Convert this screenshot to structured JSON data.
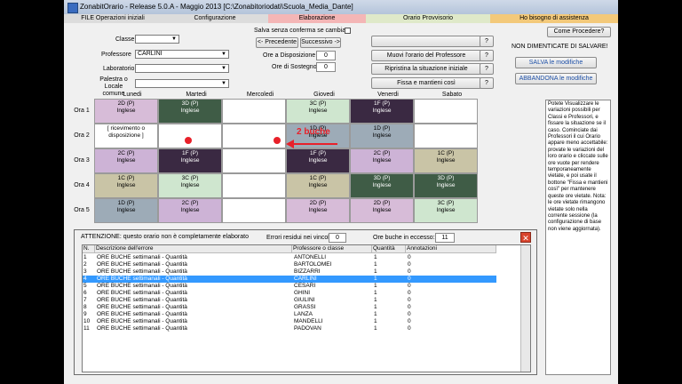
{
  "window": {
    "title": "ZonabitOrario - Release 5.0.A - Maggio 2013 [C:\\Zonabitoriodati\\Scuola_Media_Dante]"
  },
  "tabs": [
    {
      "label": "FILE Operazioni iniziali",
      "color": "#dcdcdc"
    },
    {
      "label": "Configurazione",
      "color": "#dcdcdc"
    },
    {
      "label": "Elaborazione",
      "color": "#f4b6b6"
    },
    {
      "label": "Orario Provvisorio",
      "color": "#dfe9c9"
    },
    {
      "label": "Ho bisogno di assistenza",
      "color": "#f3c97a"
    }
  ],
  "form": {
    "classe_label": "Classe",
    "professore_label": "Professore",
    "professore_value": "CARLINI",
    "laboratorio_label": "Laboratorio",
    "palestra_label": "Palestra o Locale comune",
    "conferma_label": "Salva senza conferma se cambiato",
    "precedente_label": "<- Precedente",
    "successivo_label": "Successivo ->",
    "disposizione_label": "Ore a Disposizione",
    "disposizione_value": "0",
    "sostegno_label": "Ore di Sostegno",
    "sostegno_value": "0",
    "muovi_label": "Muovi l'orario del Professore",
    "ripristina_label": "Ripristina la situazione iniziale",
    "fissa_label": "Fissa e mantieni così",
    "help_label": "?",
    "come_procedere_label": "Come Procedere?",
    "non_dimenticate_label": "NON DIMENTICATE DI SALVARE!",
    "salva_label": "SALVA le modifiche",
    "abbandona_label": "ABBANDONA le modifiche"
  },
  "timetable": {
    "days": [
      "Lunedi",
      "Martedi",
      "Mercoledi",
      "Giovedi",
      "Venerdi",
      "Sabato"
    ],
    "hours": [
      "Ora 1",
      "Ora 2",
      "Ora 3",
      "Ora 4",
      "Ora 5"
    ],
    "cells": [
      [
        {
          "l1": "2D  (P)",
          "l2": "Inglese",
          "bg": "#d7bcd8",
          "fg": "#000"
        },
        {
          "l1": "3D  (P)",
          "l2": "Inglese",
          "bg": "#3f5c46",
          "fg": "#fff"
        },
        {
          "l1": "",
          "l2": "",
          "bg": "#ffffff",
          "fg": "#000"
        },
        {
          "l1": "3C  (P)",
          "l2": "Inglese",
          "bg": "#cfe6cf",
          "fg": "#000"
        },
        {
          "l1": "1F  (P)",
          "l2": "Inglese",
          "bg": "#3a2942",
          "fg": "#fff"
        },
        {
          "l1": "",
          "l2": "",
          "bg": "#ffffff",
          "fg": "#000"
        }
      ],
      [
        {
          "l1": "[ ricevimento o",
          "l2": "disposizione ]",
          "bg": "#ffffff",
          "fg": "#000"
        },
        {
          "l1": "",
          "l2": "",
          "bg": "#ffffff",
          "fg": "#000"
        },
        {
          "l1": "",
          "l2": "",
          "bg": "#ffffff",
          "fg": "#000"
        },
        {
          "l1": "1D  (P)",
          "l2": "Inglese",
          "bg": "#9dabb7",
          "fg": "#000"
        },
        {
          "l1": "1D  (P)",
          "l2": "Inglese",
          "bg": "#9dabb7",
          "fg": "#000"
        },
        {
          "l1": "",
          "l2": "",
          "bg": "#ffffff",
          "fg": "#000"
        }
      ],
      [
        {
          "l1": "2C  (P)",
          "l2": "Inglese",
          "bg": "#cdb3d6",
          "fg": "#000"
        },
        {
          "l1": "1F  (P)",
          "l2": "Inglese",
          "bg": "#3a2942",
          "fg": "#fff"
        },
        {
          "l1": "",
          "l2": "",
          "bg": "#ffffff",
          "fg": "#000"
        },
        {
          "l1": "1F  (P)",
          "l2": "Inglese",
          "bg": "#3a2942",
          "fg": "#fff"
        },
        {
          "l1": "2C  (P)",
          "l2": "Inglese",
          "bg": "#cdb3d6",
          "fg": "#000"
        },
        {
          "l1": "1C  (P)",
          "l2": "Inglese",
          "bg": "#c9c4a6",
          "fg": "#000"
        }
      ],
      [
        {
          "l1": "1C  (P)",
          "l2": "Inglese",
          "bg": "#c9c4a6",
          "fg": "#000"
        },
        {
          "l1": "3C  (P)",
          "l2": "Inglese",
          "bg": "#cfe6cf",
          "fg": "#000"
        },
        {
          "l1": "",
          "l2": "",
          "bg": "#ffffff",
          "fg": "#000"
        },
        {
          "l1": "1C  (P)",
          "l2": "Inglese",
          "bg": "#c9c4a6",
          "fg": "#000"
        },
        {
          "l1": "3D  (P)",
          "l2": "Inglese",
          "bg": "#3f5c46",
          "fg": "#fff"
        },
        {
          "l1": "3D  (P)",
          "l2": "Inglese",
          "bg": "#3f5c46",
          "fg": "#fff"
        }
      ],
      [
        {
          "l1": "1D  (P)",
          "l2": "Inglese",
          "bg": "#9dabb7",
          "fg": "#000"
        },
        {
          "l1": "2C  (P)",
          "l2": "Inglese",
          "bg": "#cdb3d6",
          "fg": "#000"
        },
        {
          "l1": "",
          "l2": "",
          "bg": "#ffffff",
          "fg": "#000"
        },
        {
          "l1": "2D  (P)",
          "l2": "Inglese",
          "bg": "#d7bcd8",
          "fg": "#000"
        },
        {
          "l1": "2D  (P)",
          "l2": "Inglese",
          "bg": "#d7bcd8",
          "fg": "#000"
        },
        {
          "l1": "3C  (P)",
          "l2": "Inglese",
          "bg": "#cfe6cf",
          "fg": "#000"
        }
      ]
    ],
    "annotation": "2 buche",
    "accent_red": "#e8212a"
  },
  "side_help": "Potete Visualizzare le variazioni possibili per Classi e Professori, e fissare la situazione se il caso. Cominciate dai Professori il cui Orario appare meno accettabile: provate le variazioni del loro orario e cliccate sulle ore vuote per rendere temporaneamente vietate, e poi usate il bottone \"Fissa e mantieni così\" per mantenere queste ore vietate. Nota: le ore vietate rimangono vietate solo nella corrente sessione (la configurazione di base non viene aggiornata).",
  "dialog": {
    "attention": "ATTENZIONE: questo orario non è completamente elaborato",
    "errori_label": "Errori residui nei vincoli",
    "errori_value": "0",
    "buche_label": "Ore buche in eccesso:",
    "buche_value": "11",
    "close_glyph": "✕",
    "columns": [
      "N.",
      "Descrizione dell'errore",
      "Professore o classe",
      "Quantità",
      "Annotazioni"
    ],
    "rows": [
      {
        "n": "1",
        "desc": "ORE BUCHE settimanali - Quantità",
        "prof": "ANTONELLI",
        "qty": "1",
        "ann": "0"
      },
      {
        "n": "2",
        "desc": "ORE BUCHE settimanali - Quantità",
        "prof": "BARTOLOMEI",
        "qty": "1",
        "ann": "0"
      },
      {
        "n": "3",
        "desc": "ORE BUCHE settimanali - Quantità",
        "prof": "BIZZARRI",
        "qty": "1",
        "ann": "0"
      },
      {
        "n": "4",
        "desc": "ORE BUCHE settimanali - Quantità",
        "prof": "CARLINI",
        "qty": "1",
        "ann": "0"
      },
      {
        "n": "5",
        "desc": "ORE BUCHE settimanali - Quantità",
        "prof": "CESARI",
        "qty": "1",
        "ann": "0"
      },
      {
        "n": "6",
        "desc": "ORE BUCHE settimanali - Quantità",
        "prof": "GHINI",
        "qty": "1",
        "ann": "0"
      },
      {
        "n": "7",
        "desc": "ORE BUCHE settimanali - Quantità",
        "prof": "GIULINI",
        "qty": "1",
        "ann": "0"
      },
      {
        "n": "8",
        "desc": "ORE BUCHE settimanali - Quantità",
        "prof": "GRASSI",
        "qty": "1",
        "ann": "0"
      },
      {
        "n": "9",
        "desc": "ORE BUCHE settimanali - Quantità",
        "prof": "LANZA",
        "qty": "1",
        "ann": "0"
      },
      {
        "n": "10",
        "desc": "ORE BUCHE settimanali - Quantità",
        "prof": "MANDELLI",
        "qty": "1",
        "ann": "0"
      },
      {
        "n": "11",
        "desc": "ORE BUCHE settimanali - Quantità",
        "prof": "PADOVAN",
        "qty": "1",
        "ann": "0"
      }
    ],
    "selected_row": 3
  }
}
